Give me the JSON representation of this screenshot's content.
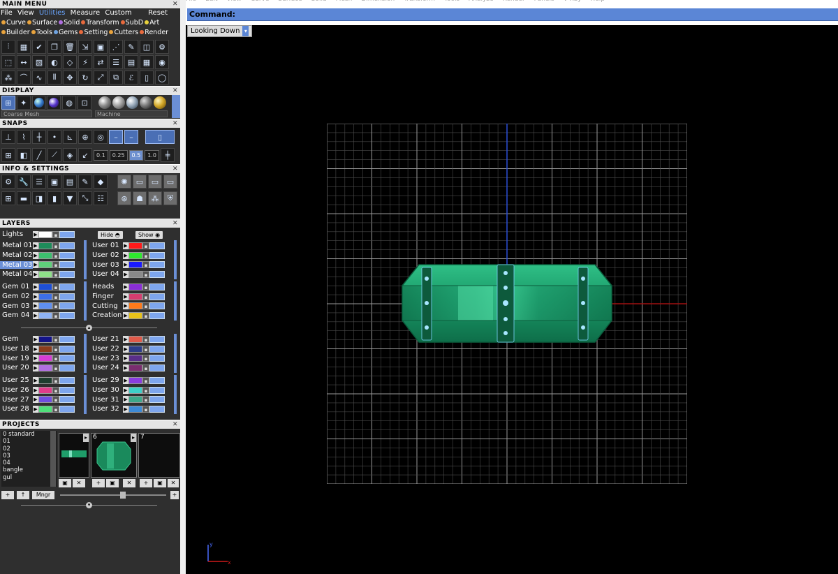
{
  "main_menu": {
    "title": "MAIN MENU",
    "menus": [
      "File",
      "View",
      "Utilities",
      "Measure",
      "Custom"
    ],
    "selected_menu": "Utilities",
    "reset_label": "Reset",
    "categories_row1": [
      {
        "label": "Curve",
        "color": "#e8a33d"
      },
      {
        "label": "Surface",
        "color": "#e8a33d"
      },
      {
        "label": "Solid",
        "color": "#b06fe0"
      },
      {
        "label": "Transform",
        "color": "#e86a3d"
      },
      {
        "label": "SubD",
        "color": "#e86a3d"
      },
      {
        "label": "Art",
        "color": "#e8d23d"
      }
    ],
    "categories_row2": [
      {
        "label": "Builder",
        "color": "#e8a33d"
      },
      {
        "label": "Tools",
        "color": "#e8a33d"
      },
      {
        "label": "Gems",
        "color": "#6fa3e0"
      },
      {
        "label": "Setting",
        "color": "#e86a3d"
      },
      {
        "label": "Cutters",
        "color": "#e8a33d"
      },
      {
        "label": "Render",
        "color": "#e86a3d"
      }
    ]
  },
  "display": {
    "title": "DISPLAY",
    "mesh_option": "Coarse Mesh",
    "material_option": "Machine"
  },
  "snaps": {
    "title": "SNAPS",
    "values": [
      "0.1",
      "0.25",
      "0.5",
      "1.0"
    ],
    "selected_value": "0.5"
  },
  "info_settings": {
    "title": "INFO & SETTINGS"
  },
  "layers": {
    "title": "LAYERS",
    "lights_label": "Lights",
    "hide_label": "Hide",
    "show_label": "Show",
    "group1_left": [
      {
        "name": "Metal 01",
        "color": "#1e8c5a"
      },
      {
        "name": "Metal 02",
        "color": "#3cbf6e"
      },
      {
        "name": "Metal 03",
        "color": "#5fd07a",
        "selected": true
      },
      {
        "name": "Metal 04",
        "color": "#8fe08a"
      }
    ],
    "group1_right": [
      {
        "name": "User 01",
        "color": "#ff1a1a"
      },
      {
        "name": "User 02",
        "color": "#2ee82e"
      },
      {
        "name": "User 03",
        "color": "#1a1aff"
      },
      {
        "name": "User 04",
        "color": "#8a8a8a"
      }
    ],
    "group2_left": [
      {
        "name": "Gem 01",
        "color": "#1e4fd6"
      },
      {
        "name": "Gem 02",
        "color": "#3d6fe8"
      },
      {
        "name": "Gem 03",
        "color": "#5f8ff0"
      },
      {
        "name": "Gem 04",
        "color": "#8fb3f5"
      }
    ],
    "group2_right": [
      {
        "name": "Heads",
        "color": "#8a2ed6"
      },
      {
        "name": "Finger",
        "color": "#d63d6f"
      },
      {
        "name": "Cutting",
        "color": "#ff7a1a"
      },
      {
        "name": "Creation",
        "color": "#e8c21a"
      }
    ],
    "group3_left": [
      {
        "name": "Gem",
        "color": "#14148a"
      },
      {
        "name": "User 18",
        "color": "#8a3d1e"
      },
      {
        "name": "User 19",
        "color": "#d63dd6"
      },
      {
        "name": "User 20",
        "color": "#b06fe0"
      }
    ],
    "group3_right": [
      {
        "name": "User 21",
        "color": "#e05a4a"
      },
      {
        "name": "User 22",
        "color": "#2e3d8a"
      },
      {
        "name": "User 23",
        "color": "#5a2e8a"
      },
      {
        "name": "User 24",
        "color": "#7a2e6f"
      }
    ],
    "group4_left": [
      {
        "name": "User 25",
        "color": "#1e3d2e"
      },
      {
        "name": "User 26",
        "color": "#e03d8a"
      },
      {
        "name": "User 27",
        "color": "#6f4fe0"
      },
      {
        "name": "User 28",
        "color": "#4fe07a"
      }
    ],
    "group4_right": [
      {
        "name": "User 29",
        "color": "#8a3de0"
      },
      {
        "name": "User 30",
        "color": "#3dcfc8"
      },
      {
        "name": "User 31",
        "color": "#3da88a"
      },
      {
        "name": "User 32",
        "color": "#3d8ad6"
      }
    ]
  },
  "projects": {
    "title": "PROJECTS",
    "list": [
      "0 standard",
      "01",
      "02",
      "03",
      "04",
      "bangle",
      "gul"
    ],
    "slots": [
      "6",
      "7"
    ],
    "mngr_label": "Mngr"
  },
  "top_menu": [
    "File",
    "Edit",
    "View",
    "Curve",
    "Surface",
    "Solid",
    "Mesh",
    "Dimension",
    "Transform",
    "Tools",
    "Analyze",
    "Render",
    "Panels",
    "V-Ray",
    "Help"
  ],
  "command": {
    "label": "Command:"
  },
  "viewport": {
    "view_name": "Looking Down",
    "axis_y": "y",
    "axis_x": "x",
    "background": "#000000",
    "object_color": "#1f9e6a"
  }
}
